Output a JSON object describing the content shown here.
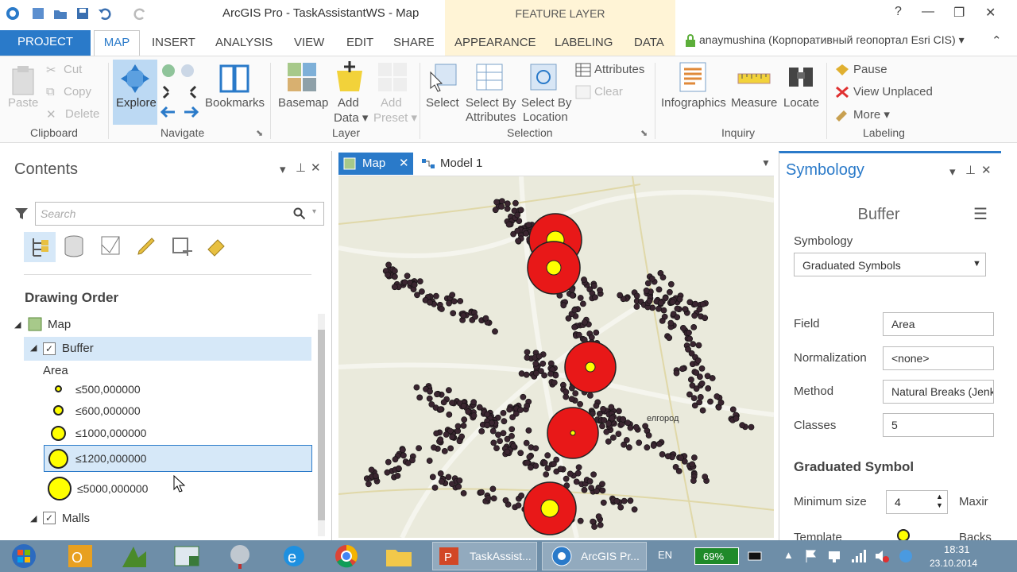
{
  "title_bar": {
    "app_title": "ArcGIS Pro - TaskAssistantWS - Map",
    "context_band": "FEATURE LAYER",
    "help": "?",
    "minimize": "—",
    "restore": "❐",
    "close": "✕"
  },
  "ribbon_tabs": {
    "project": "PROJECT",
    "tabs": [
      "MAP",
      "INSERT",
      "ANALYSIS",
      "VIEW",
      "EDIT",
      "SHARE",
      "APPEARANCE",
      "LABELING",
      "DATA"
    ],
    "user": "anaymushina (Корпоративный геопортал Esri CIS) ▾"
  },
  "ribbon": {
    "clipboard": {
      "paste": "Paste",
      "cut": "Cut",
      "copy": "Copy",
      "delete": "Delete",
      "group": "Clipboard"
    },
    "navigate": {
      "explore": "Explore",
      "bookmarks": "Bookmarks",
      "group": "Navigate"
    },
    "layer": {
      "basemap": "Basemap",
      "add_data_1": "Add",
      "add_data_2": "Data ▾",
      "add_preset_1": "Add",
      "add_preset_2": "Preset ▾",
      "group": "Layer"
    },
    "selection": {
      "select": "Select",
      "by_attr_1": "Select By",
      "by_attr_2": "Attributes",
      "by_loc_1": "Select By",
      "by_loc_2": "Location",
      "attributes": "Attributes",
      "clear": "Clear",
      "group": "Selection"
    },
    "inquiry": {
      "infographics": "Infographics",
      "measure": "Measure",
      "locate": "Locate",
      "group": "Inquiry"
    },
    "labeling": {
      "pause": "Pause",
      "view_unplaced": "View Unplaced",
      "more": "More ▾",
      "group": "Labeling"
    }
  },
  "contents": {
    "title": "Contents",
    "search_placeholder": "Search",
    "drawing_order": "Drawing Order",
    "map_node": "Map",
    "buffer_node": "Buffer",
    "field_label": "Area",
    "classes": [
      "≤500,000000",
      "≤600,000000",
      "≤1000,000000",
      "≤1200,000000",
      "≤5000,000000"
    ],
    "malls_node": "Malls"
  },
  "map_view": {
    "map_tab": "Map",
    "model_tab": "Model 1",
    "place_label": "елгород"
  },
  "symbology": {
    "title": "Symbology",
    "layer": "Buffer",
    "symbology_label": "Symbology",
    "symbology_value": "Graduated Symbols",
    "field_label": "Field",
    "field_value": "Area",
    "normalization_label": "Normalization",
    "normalization_value": "<none>",
    "method_label": "Method",
    "method_value": "Natural Breaks (Jenks",
    "classes_label": "Classes",
    "classes_value": "5",
    "graduated_heading": "Graduated Symbol",
    "min_size_label": "Minimum size",
    "min_size_value": "4",
    "max_label": "Maxir",
    "template_label": "Template",
    "back_label": "Backs"
  },
  "taskbar": {
    "powerpoint": "TaskAssist...",
    "arcgis": "ArcGIS Pr...",
    "lang": "EN",
    "battery": "69%",
    "time": "18:31",
    "date": "23.10.2014"
  },
  "colors": {
    "accent": "#2a7ac9",
    "buffer_fill": "#e81818",
    "center_fill": "#ffff00",
    "points": "#3a2530"
  }
}
